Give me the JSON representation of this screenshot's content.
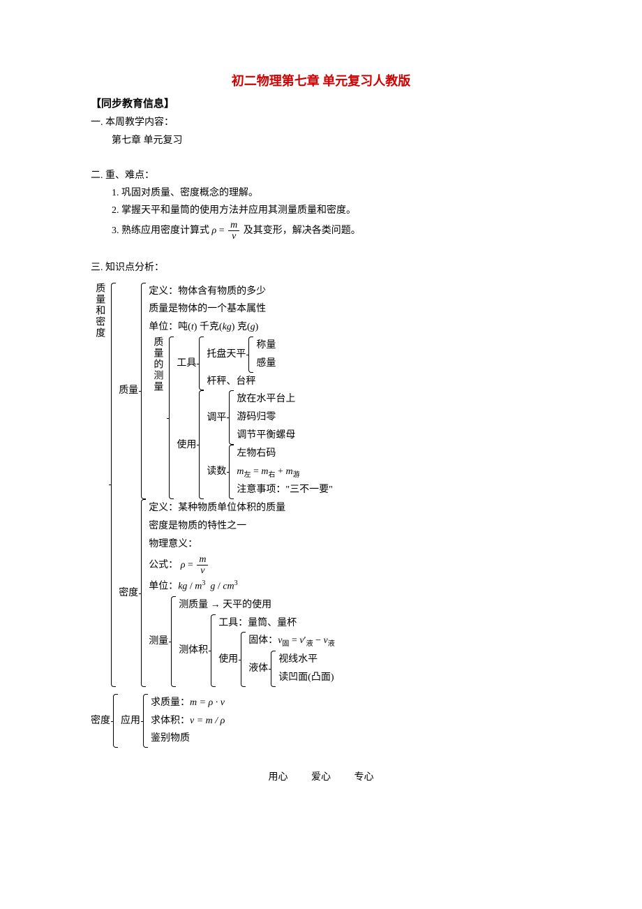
{
  "title": "初二物理第七章 单元复习人教版",
  "heading": "【同步教育信息】",
  "s1": {
    "h": "一. 本周教学内容：",
    "l1": "第七章 单元复习"
  },
  "s2": {
    "h": "二. 重、难点：",
    "l1": "1. 巩固对质量、密度概念的理解。",
    "l2": "2. 掌握天平和量筒的使用方法并应用其测量质量和密度。",
    "l3a": "3. 熟练应用密度计算式",
    "rho": "ρ",
    "eq": " = ",
    "num": "m",
    "den": "v",
    "l3b": " 及其变形，解决各类问题。"
  },
  "s3": {
    "h": "三. 知识点分析："
  },
  "root_label": "质量和密度",
  "mass": {
    "label": "质量",
    "def": "定义：物体含有物质的多少",
    "prop": "质量是物体的一个基本属性",
    "unit_pre": "单位：吨(",
    "unit_t": "t",
    "unit_mid1": ")  千克(",
    "unit_kg": "kg",
    "unit_mid2": ")  克(",
    "unit_g": "g",
    "unit_end": ")",
    "measure_label": "质量的测量",
    "tool_label": "工具",
    "tool1": "托盘天平",
    "tool1a": "称量",
    "tool1b": "感量",
    "tool2": "杆秤、台秤",
    "use_label": "使用",
    "adjust_label": "调平",
    "adj1": "放在水平台上",
    "adj2": "游码归零",
    "adj3": "调节平衡螺母",
    "read_label": "读数",
    "read1": "左物右码",
    "read2a": "m",
    "read2_left": "左",
    "read2_eq": " = ",
    "read2_right": "右",
    "read2_plus": " + ",
    "read2_you": "游",
    "read3": "注意事项：\"三不一要\""
  },
  "density": {
    "label": "密度",
    "def": "定义：某种物质单位体积的质量",
    "prop": "密度是物质的特性之一",
    "meaning": "物理意义：",
    "formula_pre": "公式：",
    "rho": "ρ",
    "eq": " = ",
    "num": "m",
    "den": "v",
    "unit_pre": "单位：",
    "unit1a": "kg",
    "unit1b": "m",
    "unit2a": "g",
    "unit2b": "cm",
    "measure_label": "测量",
    "mmass": "测质量 → 天平的使用",
    "mvol_label": "测体积",
    "volTool": "工具：量筒、量杯",
    "volUse_label": "使用",
    "solid_pre": "固体：",
    "v": "v",
    "solid_sub": "固",
    "liq_sub": "液",
    "prime": "′",
    "minus": " − ",
    "liquid_label": "液体",
    "liq1": "视线水平",
    "liq2": "读凹面(凸面)"
  },
  "app": {
    "label_root": "密度",
    "label": "应用",
    "l1": "求质量：",
    "f1": "m = ρ · v",
    "l2": "求体积：",
    "f2": "v = m / ρ",
    "l3": "鉴别物质"
  },
  "footer": {
    "a": "用心",
    "b": "爱心",
    "c": "专心"
  }
}
